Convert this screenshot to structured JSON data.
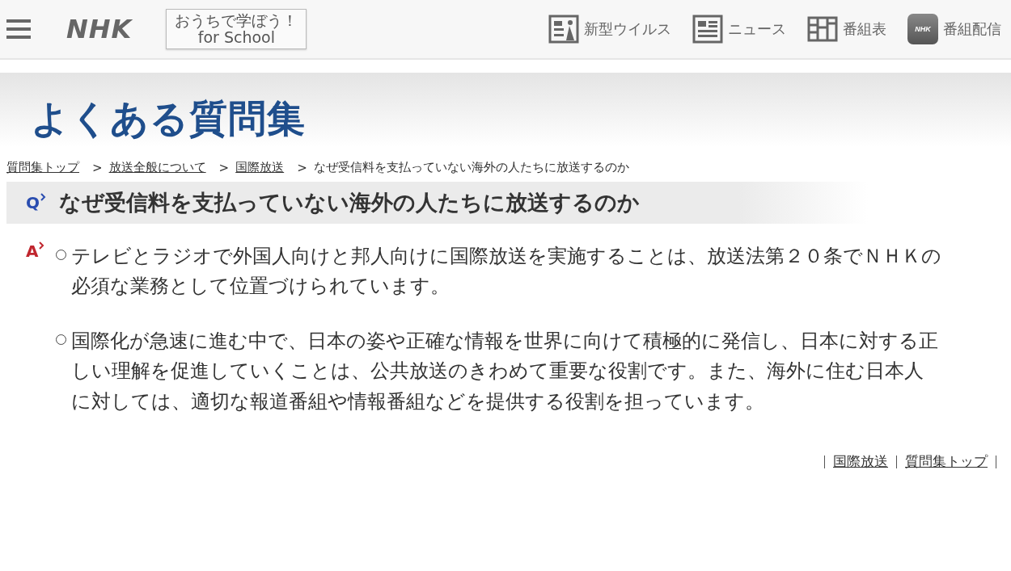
{
  "header": {
    "logo": "NHK",
    "school_button": {
      "line1": "おうちで学ぼう！",
      "line2": "for School"
    },
    "nav": [
      {
        "kind": "virus",
        "label": "新型ウイルス"
      },
      {
        "kind": "news",
        "label": "ニュース"
      },
      {
        "kind": "schedule",
        "label": "番組表"
      },
      {
        "kind": "app",
        "label": "番組配信",
        "badge": "NHK"
      }
    ]
  },
  "banner": {
    "title": "よくある質問集"
  },
  "breadcrumbs": [
    {
      "label": "質問集トップ",
      "link": true
    },
    {
      "separator": ">",
      "label": "放送全般について",
      "link": true
    },
    {
      "separator": ">",
      "label": "国際放送",
      "link": true
    },
    {
      "separator": ">",
      "label": "なぜ受信料を支払っていない海外の人たちに放送するのか",
      "link": false
    }
  ],
  "question": {
    "mark": "Q",
    "text": "なぜ受信料を支払っていない海外の人たちに放送するのか"
  },
  "answer": {
    "mark": "A",
    "paragraphs": [
      "テレビとラジオで外国人向けと邦人向けに国際放送を実施することは、放送法第２０条でＮＨＫの必須な業務として位置づけられています。",
      "国際化が急速に進む中で、日本の姿や正確な情報を世界に向けて積極的に発信し、日本に対する正しい理解を促進していくことは、公共放送のきわめて重要な役割です。また、海外に住む日本人に対しては、適切な報道番組や情報番組などを提供する役割を担っています。"
    ]
  },
  "footer_links": [
    "国際放送",
    "質問集トップ"
  ]
}
